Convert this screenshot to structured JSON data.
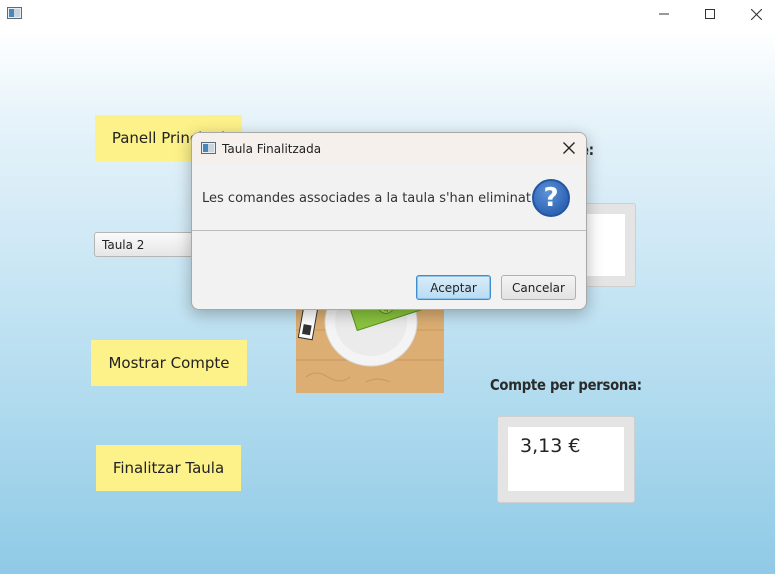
{
  "window": {
    "title": "",
    "controls": [
      "minimize-icon",
      "maximize-icon",
      "close-icon"
    ]
  },
  "left_panel": {
    "panell_principal_label": "Panell Principal",
    "table_select_value": "Taula 2",
    "mostrar_compte_label": "Mostrar Compte",
    "finalitzar_taula_label": "Finalitzar Taula"
  },
  "right_panel": {
    "total_heading_visible_fragment": "e:",
    "per_person_heading": "Compte per persona:",
    "per_person_value": "3,13 €"
  },
  "dialog": {
    "title": "Taula Finalitzada",
    "message": "Les comandes associades a la taula s'han eliminat",
    "icon": "question-icon",
    "ok_label": "Aceptar",
    "cancel_label": "Cancelar"
  },
  "colors": {
    "button_yellow": "#fdf18a",
    "dialog_default_border": "#3e8ecf",
    "question_icon": "#2f64b5"
  }
}
